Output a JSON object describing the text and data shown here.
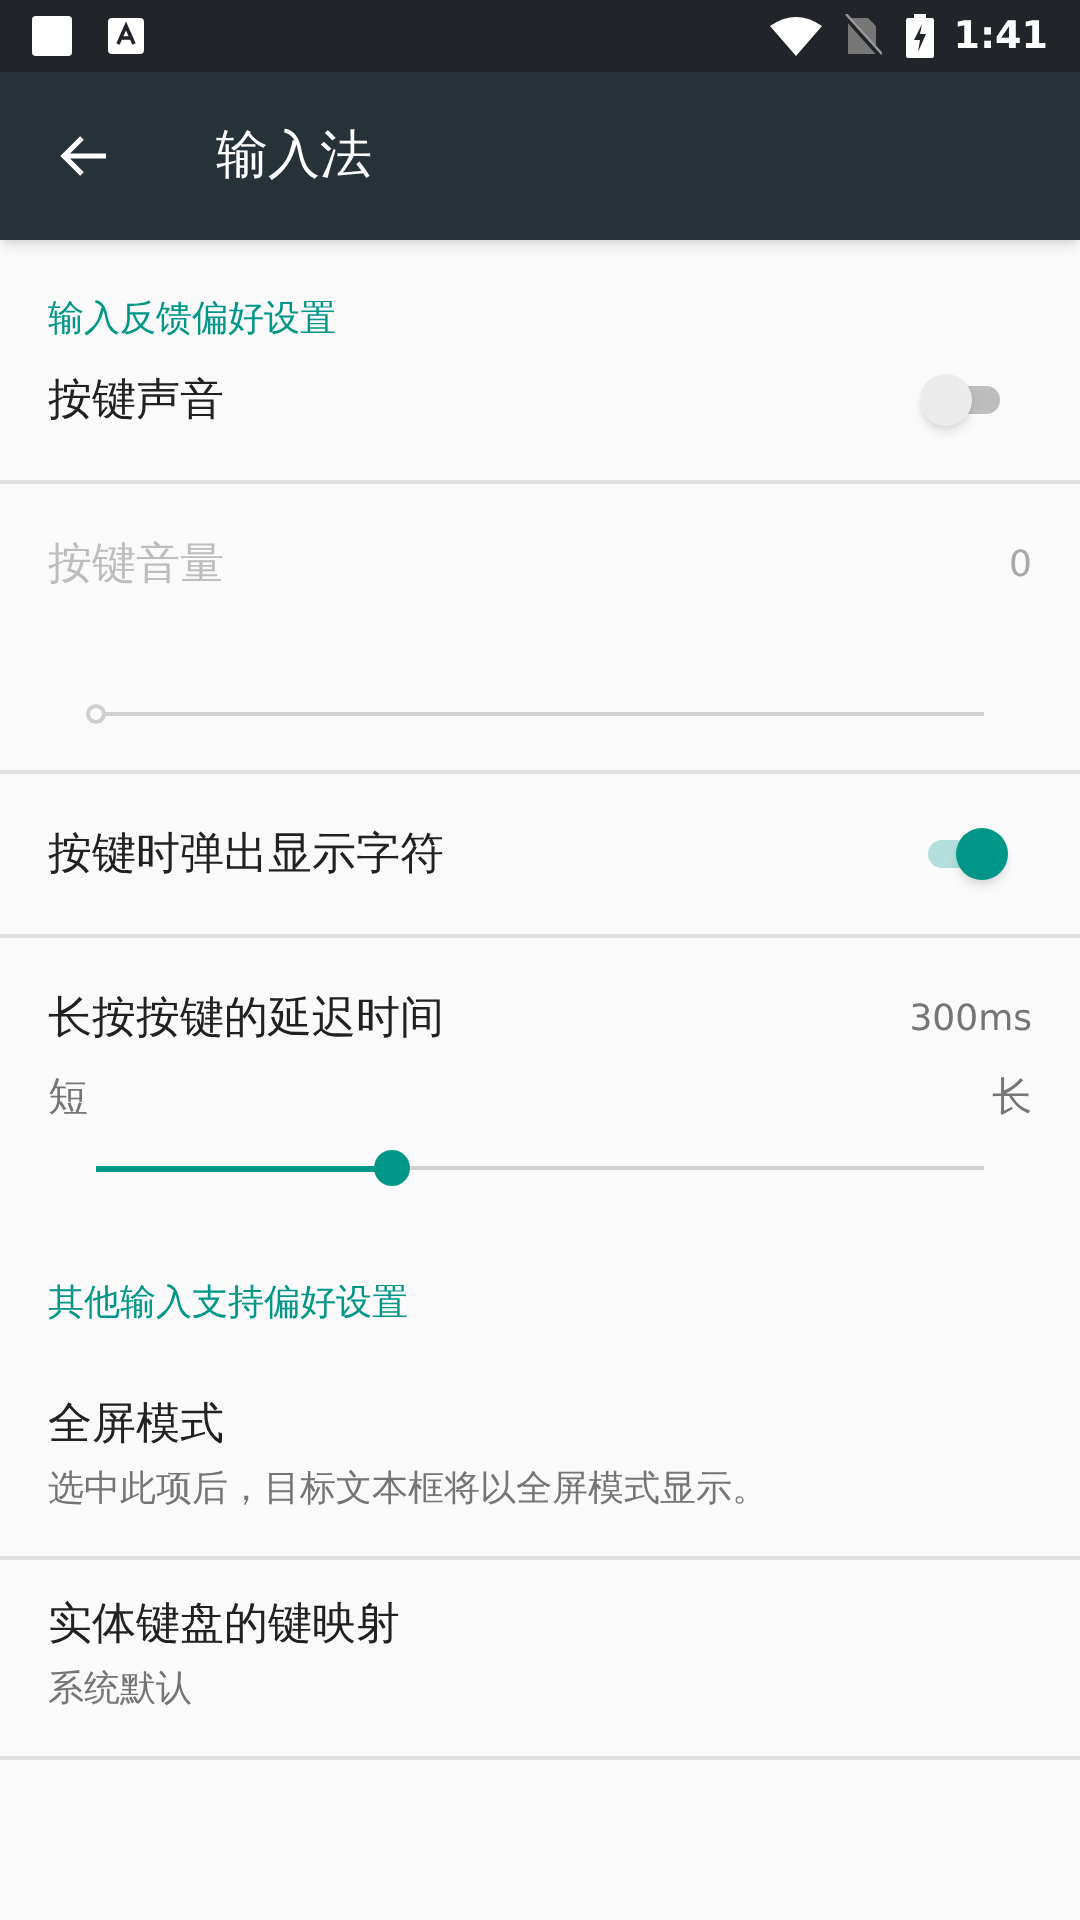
{
  "status_bar": {
    "time": "1:41"
  },
  "app_bar": {
    "title": "输入法"
  },
  "sections": [
    {
      "title": "输入反馈偏好设置",
      "items": [
        {
          "kind": "switch",
          "title": "按键声音",
          "on": false,
          "disabled": false
        },
        {
          "kind": "slider",
          "title": "按键音量",
          "reading": "0",
          "level": 0,
          "disabled": true
        },
        {
          "kind": "switch",
          "title": "按键时弹出显示字符",
          "on": true,
          "disabled": false
        },
        {
          "kind": "slider",
          "title": "长按按键的延迟时间",
          "reading": "300ms",
          "min_label": "短",
          "max_label": "长",
          "level": 0.333,
          "disabled": false
        }
      ]
    },
    {
      "title": "其他输入支持偏好设置",
      "items": [
        {
          "kind": "text",
          "title": "全屏模式",
          "summary": "选中此项后，目标文本框将以全屏模式显示。",
          "disabled": false
        },
        {
          "kind": "text",
          "title": "实体键盘的键映射",
          "summary": "系统默认",
          "disabled": false
        }
      ]
    }
  ]
}
